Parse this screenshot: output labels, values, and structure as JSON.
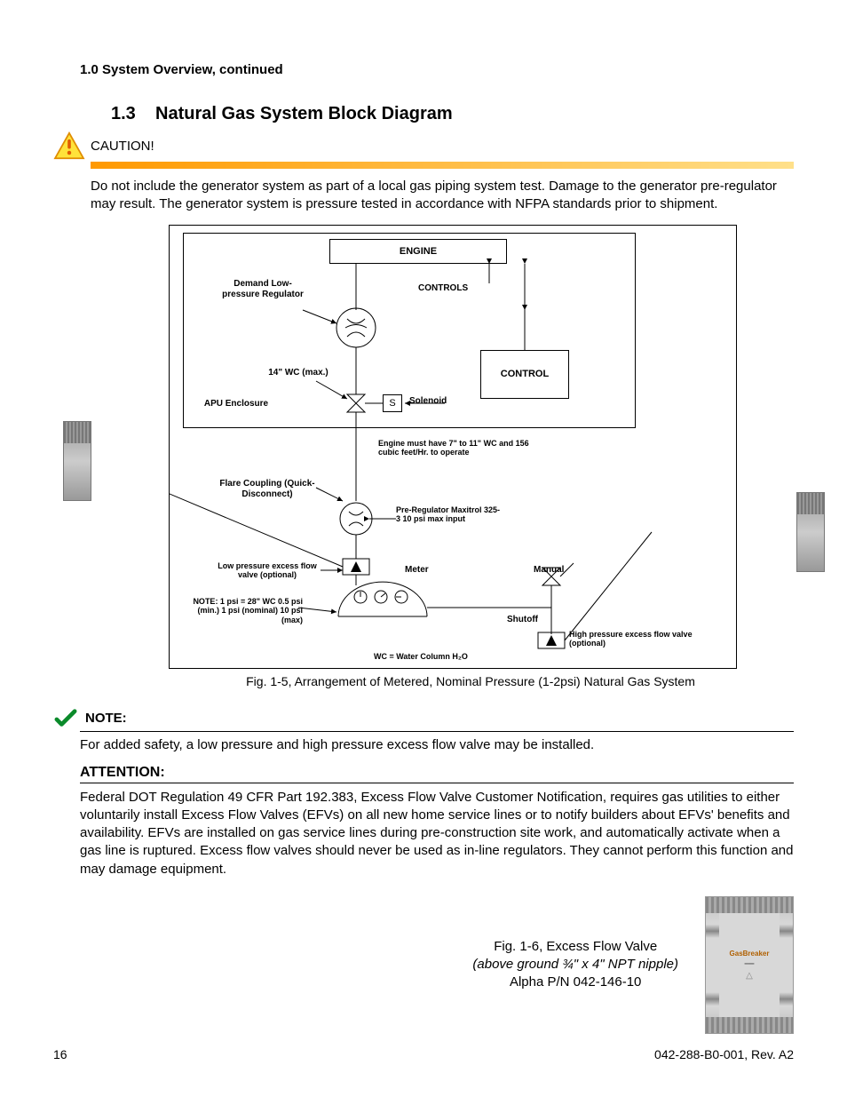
{
  "header": "1.0    System Overview, continued",
  "section_num": "1.3",
  "section_title": "Natural Gas System Block Diagram",
  "caution": {
    "label": "CAUTION!",
    "body": "Do not include the generator system as part of a local gas piping system test. Damage to the generator pre-regulator may result. The generator system is pressure tested in accordance with NFPA standards prior to shipment."
  },
  "diagram": {
    "engine": "ENGINE",
    "controls": "CONTROLS",
    "control": "CONTROL",
    "solenoid": "Solenoid",
    "s": "S",
    "apu": "APU Enclosure",
    "demand": "Demand Low-pressure Regulator",
    "wc14": "14\" WC (max.)",
    "enginenote": "Engine must have 7\" to 11\" WC and 156 cubic feet/Hr. to operate",
    "flare": "Flare Coupling (Quick-Disconnect)",
    "prereg": "Pre-Regulator Maxitrol 325-3 10 psi max input",
    "lowp": "Low pressure excess flow valve (optional)",
    "meter": "Meter",
    "manual": "Manual",
    "shutoff": "Shutoff",
    "highp": "High pressure excess flow valve (optional)",
    "notepsi": "NOTE: 1 psi = 28\" WC 0.5 psi (min.) 1 psi (nominal) 10 psi (max)",
    "wcdef": "WC = Water Column H₂O"
  },
  "fig1_caption": "Fig. 1-5, Arrangement of Metered, Nominal Pressure (1-2psi) Natural Gas System",
  "note": {
    "label": "NOTE:",
    "body": "For added safety, a low pressure and high pressure excess flow valve may be installed."
  },
  "attention": {
    "label": "ATTENTION:",
    "body": "Federal DOT Regulation 49 CFR Part 192.383, Excess Flow Valve Customer Notification, requires gas utilities to either voluntarily install Excess Flow Valves (EFVs) on all new home service lines or to notify builders about EFVs' benefits and availability. EFVs are installed on gas service lines during pre-construction site work, and automatically activate when a gas line is ruptured. Excess flow valves should never be used as in-line regulators. They cannot perform this function and may damage equipment."
  },
  "fig2": {
    "line1": "Fig. 1-6, Excess Flow Valve",
    "line2": "(above ground ¾\" x 4\" NPT nipple)",
    "line3": "Alpha P/N 042-146-10",
    "photo_label": "GasBreaker"
  },
  "footer": {
    "page": "16",
    "doc": "042-288-B0-001, Rev. A2"
  }
}
